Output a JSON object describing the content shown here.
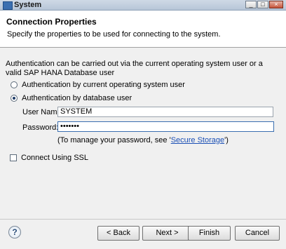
{
  "window": {
    "title": "System",
    "min": "_",
    "max": "□",
    "close": "×"
  },
  "header": {
    "title": "Connection Properties",
    "description": "Specify the properties to be used for connecting to the system."
  },
  "auth": {
    "description": "Authentication can be carried out via the current operating system user or a valid SAP HANA Database user",
    "option_os": "Authentication by current operating system user",
    "option_db": "Authentication by database user",
    "selected": "option_db"
  },
  "fields": {
    "username_label": "User Name:",
    "username_value": "SYSTEM",
    "password_label": "Password:",
    "password_value": "•••••••"
  },
  "hint": {
    "prefix": "(To manage your password, see '",
    "link": "Secure Storage",
    "suffix": "')"
  },
  "ssl": {
    "label": "Connect Using SSL",
    "checked": false
  },
  "buttons": {
    "back": "< Back",
    "next": "Next >",
    "finish": "Finish",
    "cancel": "Cancel"
  },
  "help_icon": "?"
}
